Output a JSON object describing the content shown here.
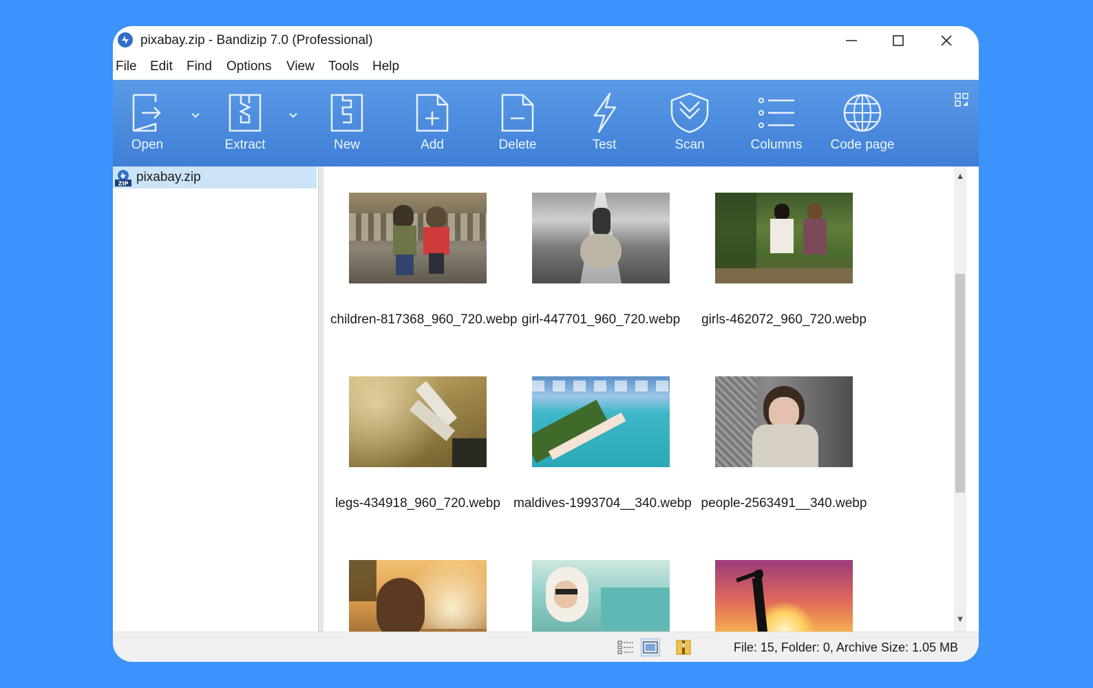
{
  "window": {
    "title": "pixabay.zip - Bandizip 7.0 (Professional)"
  },
  "menu": [
    "File",
    "Edit",
    "Find",
    "Options",
    "View",
    "Tools",
    "Help"
  ],
  "toolbar": {
    "open": "Open",
    "extract": "Extract",
    "new": "New",
    "add": "Add",
    "delete": "Delete",
    "test": "Test",
    "scan": "Scan",
    "columns": "Columns",
    "code_page": "Code page"
  },
  "tree": {
    "archive": "pixabay.zip"
  },
  "files": [
    {
      "name": "children-817368_960_720.webp"
    },
    {
      "name": "girl-447701_960_720.webp"
    },
    {
      "name": "girls-462072_960_720.webp"
    },
    {
      "name": "legs-434918_960_720.webp"
    },
    {
      "name": "maldives-1993704__340.webp"
    },
    {
      "name": "people-2563491__340.webp"
    }
  ],
  "status": {
    "text": "File: 15, Folder: 0, Archive Size: 1.05 MB"
  },
  "colors": {
    "background": "#3b93fb",
    "toolbar": "#4a89dc",
    "selection": "#cce4f7"
  }
}
